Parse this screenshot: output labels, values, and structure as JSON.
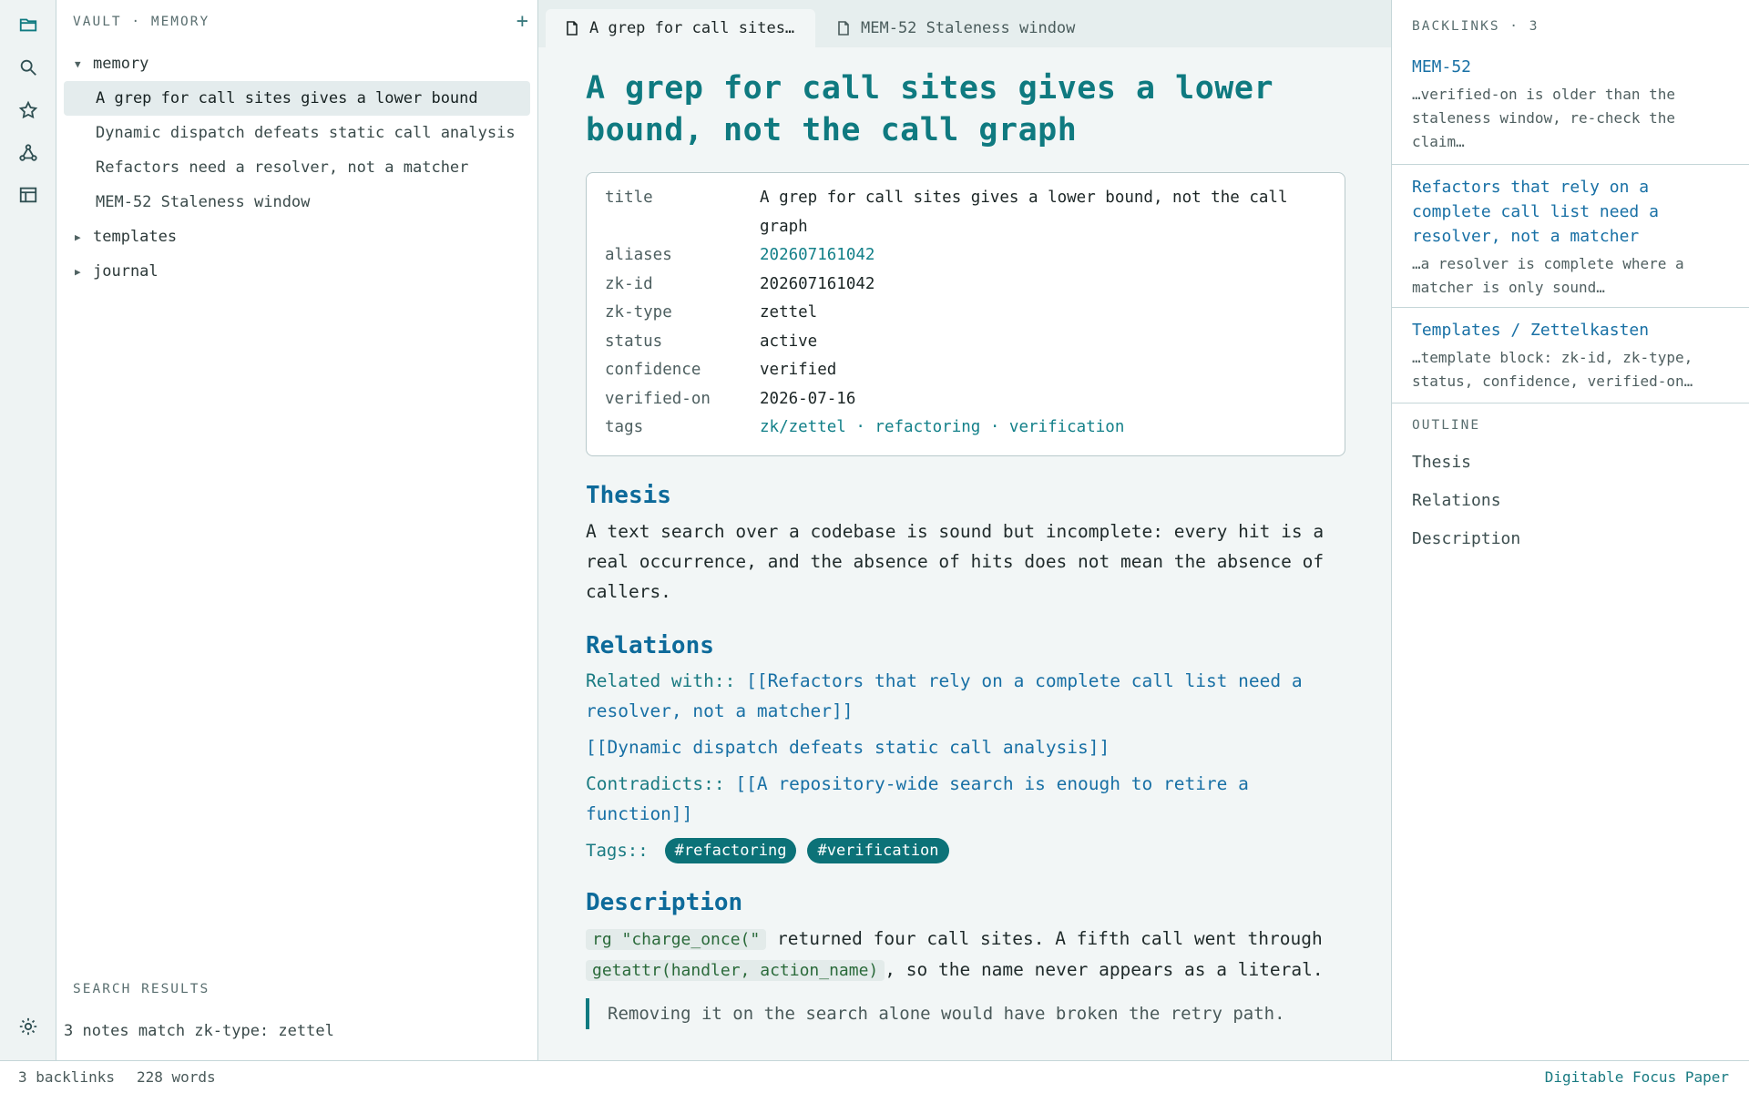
{
  "ribbon": {
    "icons": [
      "folder-icon",
      "search-icon",
      "star-icon",
      "graph-icon",
      "table-icon",
      "settings-icon"
    ],
    "accent": "#0f7a80"
  },
  "explorer": {
    "header": "VAULT · MEMORY",
    "add_label": "+",
    "tree": [
      {
        "type": "folder",
        "expanded": true,
        "label": "memory"
      },
      {
        "type": "note",
        "label": "A grep for call sites gives a lower bound",
        "active": true
      },
      {
        "type": "note",
        "label": "Dynamic dispatch defeats static call analysis"
      },
      {
        "type": "note",
        "label": "Refactors need a resolver, not a matcher"
      },
      {
        "type": "note",
        "label": "MEM-52 Staleness window"
      },
      {
        "type": "folder",
        "expanded": false,
        "label": "templates"
      },
      {
        "type": "folder",
        "expanded": false,
        "label": "journal"
      }
    ],
    "search_header": "SEARCH RESULTS",
    "search_result": "3 notes match zk-type: zettel"
  },
  "tabs": [
    {
      "label": "A grep for call sites…",
      "active": true
    },
    {
      "label": "MEM-52 Staleness window",
      "active": false
    }
  ],
  "note": {
    "title_line1": "A grep for call sites gives a lower",
    "title_line2": "bound, not the call graph",
    "properties": [
      {
        "key": "title",
        "value": "A grep for call sites gives a lower bound, not the call graph",
        "link": false
      },
      {
        "key": "aliases",
        "value": "202607161042",
        "link": true
      },
      {
        "key": "zk-id",
        "value": "202607161042",
        "link": false
      },
      {
        "key": "zk-type",
        "value": "zettel",
        "link": false
      },
      {
        "key": "status",
        "value": "active",
        "link": false
      },
      {
        "key": "confidence",
        "value": "verified",
        "link": false
      },
      {
        "key": "verified-on",
        "value": "2026-07-16",
        "link": false
      },
      {
        "key": "tags",
        "value": "zk/zettel · refactoring · verification",
        "link": true
      }
    ],
    "thesis_heading": "Thesis",
    "thesis_text": "A text search over a codebase is sound but incomplete: every hit is a real occurrence, and the absence of hits does not mean the absence of callers.",
    "relations_heading": "Relations",
    "related_key": "Related with::",
    "related_link1": "[[Refactors that rely on a complete call list need a resolver, not a matcher]]",
    "related_link2": "[[Dynamic dispatch defeats static call analysis]]",
    "contradicts_key": "Contradicts::",
    "contradicts_link": "[[A repository-wide search is enough to retire a function]]",
    "tags_key": "Tags::",
    "tags": [
      "#refactoring",
      "#verification"
    ],
    "description_heading": "Description",
    "desc_code1": "rg \"charge_once(\"",
    "desc_text1": " returned four call sites. A fifth call went through ",
    "desc_code2": "getattr(handler, action_name)",
    "desc_text2": ", so the name never appears as a literal.",
    "quote": "Removing it on the search alone would have broken the retry path."
  },
  "backlinks": {
    "header": "BACKLINKS · 3",
    "items": [
      {
        "title": "MEM-52",
        "snippet": "…verified-on is older than the staleness window, re-check the claim…"
      },
      {
        "title": "Refactors that rely on a complete call list need a resolver, not a matcher",
        "snippet": "…a resolver is complete where a matcher is only sound…"
      },
      {
        "title": "Templates / Zettelkasten",
        "snippet": "…template block: zk-id, zk-type, status, confidence, verified-on…"
      }
    ]
  },
  "outline": {
    "header": "OUTLINE",
    "items": [
      "Thesis",
      "Relations",
      "Description"
    ]
  },
  "statusbar": {
    "backlinks": "3 backlinks",
    "words": "228 words",
    "theme": "Digitable Focus Paper"
  }
}
